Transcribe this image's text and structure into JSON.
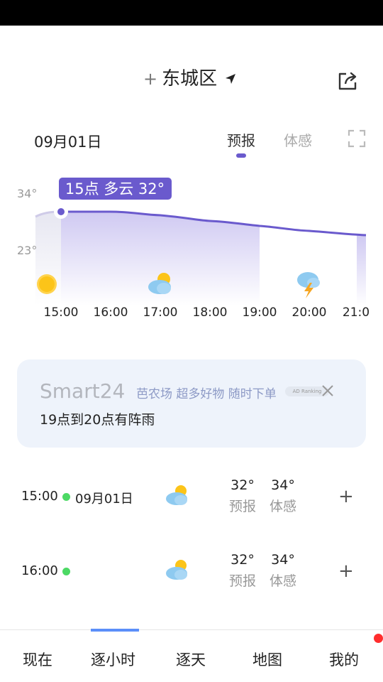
{
  "header": {
    "add_symbol": "+",
    "city": "东城区",
    "icons": {
      "locate": "locate-arrow-icon",
      "share": "share-icon"
    }
  },
  "date_row": {
    "date": "09月01日",
    "tabs": [
      {
        "label": "预报",
        "active": true
      },
      {
        "label": "体感",
        "active": false
      }
    ],
    "expand_icon": "fullscreen-icon"
  },
  "hourly_chart": {
    "tooltip": "15点 多云 32°",
    "y_labels": [
      "34°",
      "23°"
    ],
    "accent_color": "#6a5acd",
    "times": [
      "15:00",
      "16:00",
      "17:00",
      "18:00",
      "19:00",
      "20:00",
      "21:0"
    ],
    "icons": [
      "sun-icon",
      "",
      "partly-cloudy-icon",
      "",
      "",
      "thunderstorm-icon",
      ""
    ]
  },
  "ad_card": {
    "brand": "Smart24",
    "ad_text": "芭农场 超多好物 随时下单",
    "ad_badge": "AD Ranking",
    "message": "19点到20点有阵雨"
  },
  "hourly_list": [
    {
      "time": "15:00",
      "date": "09月01日",
      "icon": "partly-cloudy-icon",
      "forecast": "32°",
      "forecast_label": "预报",
      "feel": "34°",
      "feel_label": "体感",
      "add": "+"
    },
    {
      "time": "16:00",
      "date": "",
      "icon": "partly-cloudy-icon",
      "forecast": "32°",
      "forecast_label": "预报",
      "feel": "34°",
      "feel_label": "体感",
      "add": "+"
    }
  ],
  "bottom_nav": [
    {
      "label": "现在",
      "active": false
    },
    {
      "label": "逐小时",
      "active": true
    },
    {
      "label": "逐天",
      "active": false
    },
    {
      "label": "地图",
      "active": false
    },
    {
      "label": "我的",
      "active": false
    }
  ]
}
